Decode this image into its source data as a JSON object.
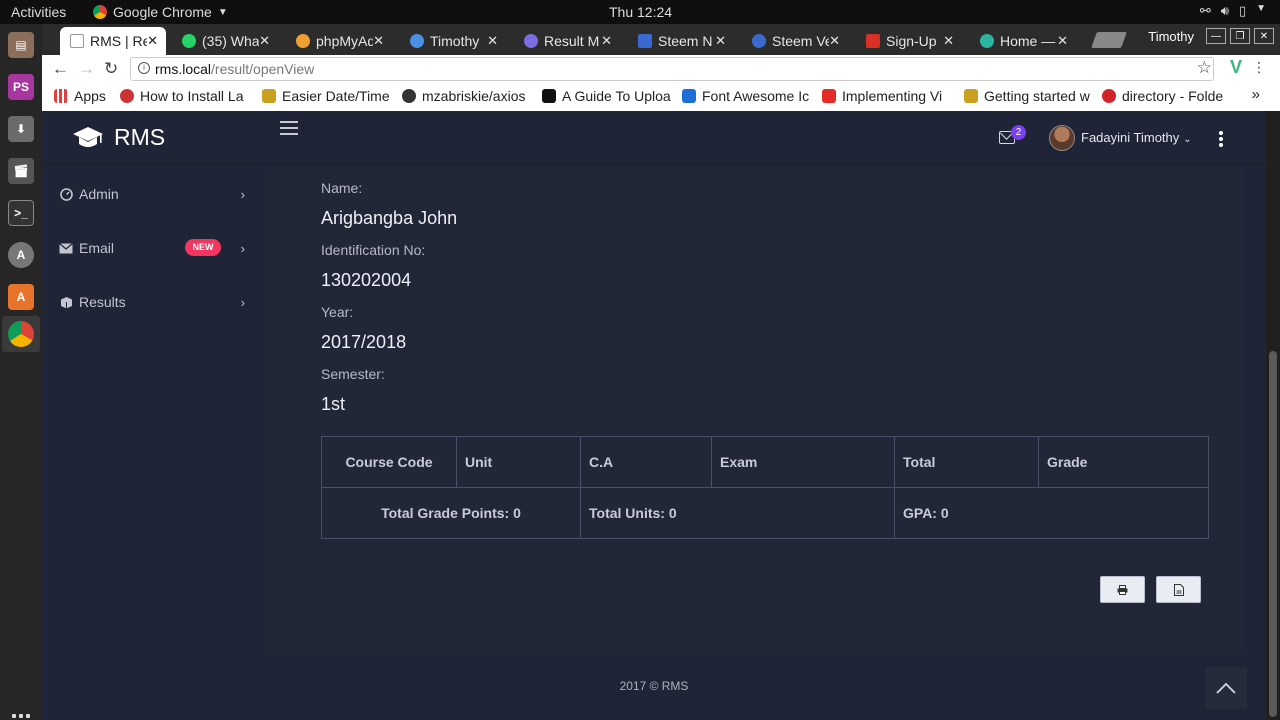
{
  "os_bar": {
    "activities": "Activities",
    "app_name": "Google Chrome",
    "clock": "Thu 12:24"
  },
  "browser": {
    "profile_name": "Timothy",
    "tabs": [
      {
        "title": "RMS | Re",
        "active": true,
        "favicon_color": "#ffffff"
      },
      {
        "title": "(35) Wha",
        "active": false,
        "favicon_color": "#25d366"
      },
      {
        "title": "phpMyAd",
        "active": false,
        "favicon_color": "#f0a030"
      },
      {
        "title": "Timothy",
        "active": false,
        "favicon_color": "#4a90e2"
      },
      {
        "title": "Result M",
        "active": false,
        "favicon_color": "#7a6ee0"
      },
      {
        "title": "Steem N",
        "active": false,
        "favicon_color": "#3a6ad0"
      },
      {
        "title": "Steem Ve",
        "active": false,
        "favicon_color": "#3a6ad0"
      },
      {
        "title": "Sign-Up",
        "active": false,
        "favicon_color": "#d93025"
      },
      {
        "title": "Home —",
        "active": false,
        "favicon_color": "#2bb5a0"
      }
    ],
    "url": {
      "host": "rms.local",
      "path": "/result/openView"
    },
    "bookmarks": [
      {
        "title": "Apps",
        "icon_color": "#e04040"
      },
      {
        "title": "How to Install La",
        "icon_color": "#cc3333"
      },
      {
        "title": "Easier Date/Time",
        "icon_color": "#c9a020"
      },
      {
        "title": "mzabriskie/axios",
        "icon_color": "#333333"
      },
      {
        "title": "A Guide To Uploa",
        "icon_color": "#111111"
      },
      {
        "title": "Font Awesome Ic",
        "icon_color": "#1d6fd6"
      },
      {
        "title": "Implementing Vi",
        "icon_color": "#e52d27"
      },
      {
        "title": "Getting started w",
        "icon_color": "#c9a020"
      },
      {
        "title": "directory - Folde",
        "icon_color": "#d0242a"
      }
    ]
  },
  "app": {
    "brand": "RMS",
    "mail_count": "2",
    "user_name": "Fadayini Timothy",
    "sidebar": [
      {
        "label": "Admin",
        "icon": "dashboard-icon"
      },
      {
        "label": "Email",
        "icon": "envelope-icon",
        "badge": "NEW"
      },
      {
        "label": "Results",
        "icon": "cubes-icon"
      }
    ],
    "result": {
      "name_label": "Name:",
      "name_value": "Arigbangba John",
      "id_label": "Identification No:",
      "id_value": "130202004",
      "year_label": "Year:",
      "year_value": "2017/2018",
      "semester_label": "Semester:",
      "semester_value": "1st",
      "columns": [
        "Course Code",
        "Unit",
        "C.A",
        "Exam",
        "Total",
        "Grade"
      ],
      "summary": {
        "total_grade_points": "Total Grade Points: 0",
        "total_units": "Total Units: 0",
        "gpa": "GPA: 0"
      }
    },
    "footer": "2017 © RMS"
  }
}
